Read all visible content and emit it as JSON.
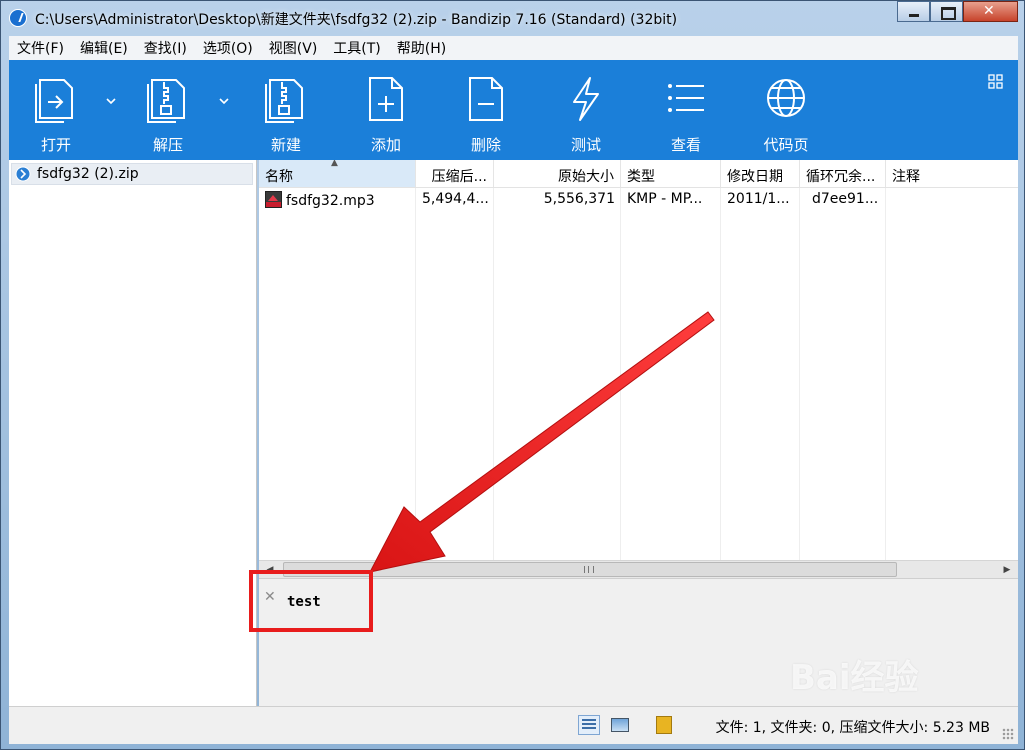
{
  "window": {
    "title": "C:\\Users\\Administrator\\Desktop\\新建文件夹\\fsdfg32 (2).zip - Bandizip 7.16 (Standard) (32bit)"
  },
  "menu": [
    "文件(F)",
    "编辑(E)",
    "查找(I)",
    "选项(O)",
    "视图(V)",
    "工具(T)",
    "帮助(H)"
  ],
  "toolbar": {
    "open": "打开",
    "extract": "解压",
    "new": "新建",
    "add": "添加",
    "delete": "删除",
    "test": "测试",
    "view": "查看",
    "codepage": "代码页"
  },
  "tree": {
    "archive": "fsdfg32 (2).zip"
  },
  "columns": [
    "名称",
    "压缩后...",
    "原始大小",
    "类型",
    "修改日期",
    "循环冗余...",
    "注释"
  ],
  "files": [
    {
      "name": "fsdfg32.mp3",
      "compressed": "5,494,4...",
      "original": "5,556,371",
      "type": "KMP - MP...",
      "modified": "2011/1...",
      "crc": "d7ee91...",
      "comment": ""
    }
  ],
  "comment": {
    "text": "test"
  },
  "status": {
    "summary": "文件: 1, 文件夹: 0, 压缩文件大小: 5.23 MB"
  },
  "watermark": "Bai经验",
  "colors": {
    "toolbar": "#1b7fd9",
    "annotation": "#e81c1c"
  }
}
